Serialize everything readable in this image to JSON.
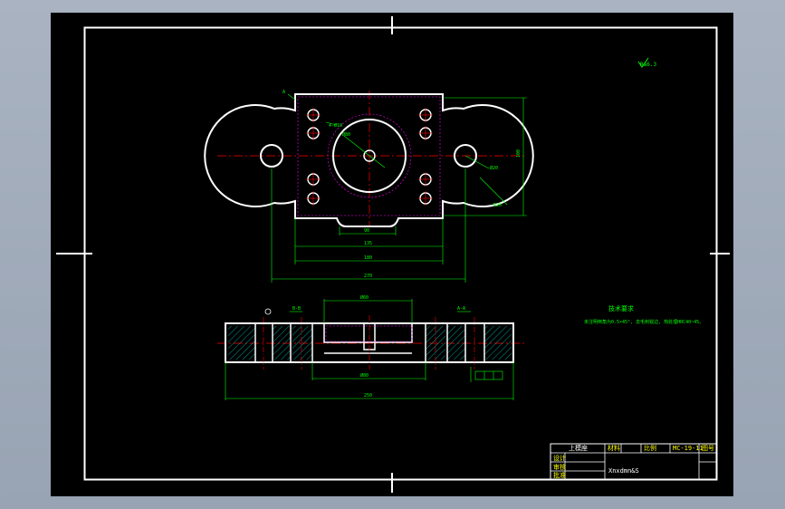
{
  "drawing": {
    "roughness_symbol": "Ra6.3",
    "tech_req_title": "技术要求",
    "tech_req_text": "未注明倒角为0.5×45°, 去毛刺锐边, 热处理HRC40~45。",
    "dims": {
      "top_width_inner": "90",
      "top_width_mid": "135",
      "top_width_outer": "180",
      "overall_length": "270",
      "height_side": "100",
      "hole_dia": "Ø20",
      "hole_r": "R20",
      "center_bore": "Ø80",
      "small_hole": "4-Ø10",
      "section_top": "Ø60",
      "section_bottom": "Ø80",
      "section_length": "250",
      "section_left_label": "B-B",
      "section_right_label": "A-A",
      "datum": "A"
    },
    "colors": {
      "background": "#000000",
      "outline": "#ffffff",
      "dimension": "#00ff00",
      "hidden": "#ff00ff",
      "center": "#ff0000",
      "hatch": "#00ffff"
    }
  },
  "title_block": {
    "designer_label": "上模座",
    "material_label": "材料",
    "scale_label": "比例",
    "drawing_no": "MC-19-11",
    "sheet_label": "图号",
    "school_label": "Xnxdmn&S",
    "row_labels": [
      "设计",
      "审核",
      "批准"
    ]
  }
}
